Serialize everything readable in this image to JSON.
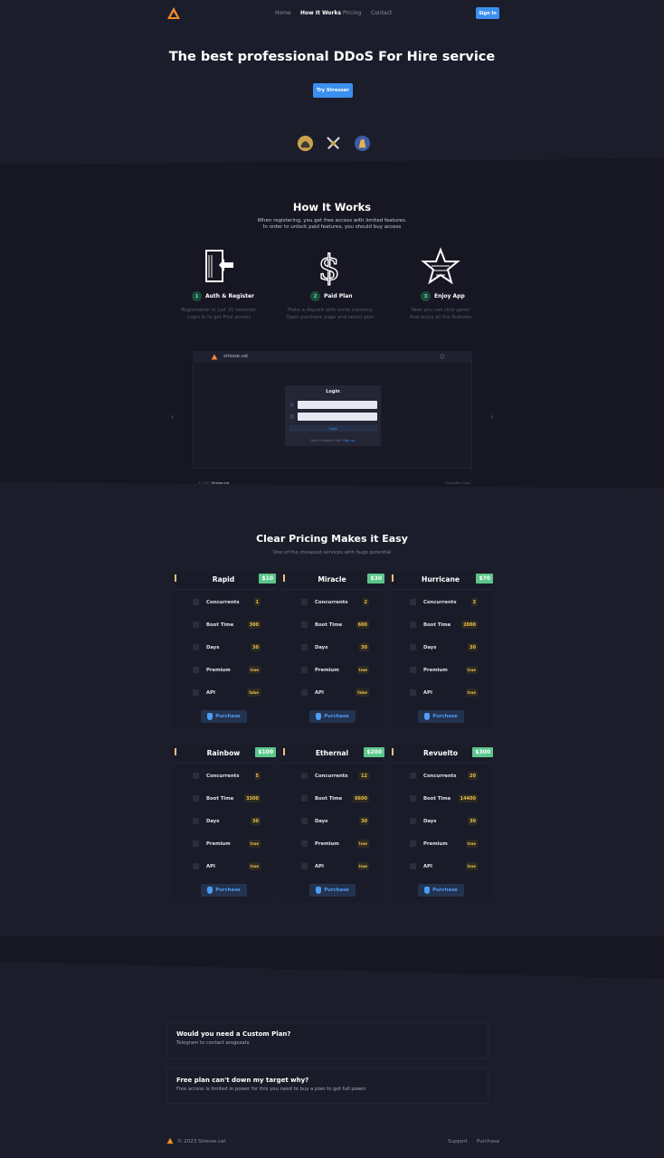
{
  "header": {
    "nav": [
      "Home",
      "How It Works",
      "Pricing",
      "Contact"
    ],
    "active_index": 1,
    "signin_label": "Sign In"
  },
  "hero": {
    "title": "The best professional DDoS For Hire service",
    "cta_label": "Try Stresser"
  },
  "how": {
    "title": "How It Works",
    "subtitle_1": "When registering, you get free access with limited features.",
    "subtitle_2": "In order to unlock paid features, you should buy access",
    "steps": [
      {
        "num": "1",
        "label": "Auth & Register",
        "desc_1": "Registration in just 15 seconds!",
        "desc_2": "Login in to get Free access",
        "icon": "door-enter-icon"
      },
      {
        "num": "2",
        "label": "Paid Plan",
        "desc_1": "Make a deposit with some currency",
        "desc_2": "Open purchase page and select plan",
        "icon": "dollar-icon"
      },
      {
        "num": "3",
        "label": "Enjoy App",
        "desc_1": "Now you can click panel",
        "desc_2": "And enjoy all the features",
        "icon": "star-icon"
      }
    ]
  },
  "mockup": {
    "url": "stresse.cat",
    "login_title": "Login",
    "login_button": "Login",
    "login_footer_text": "Not a member yet?",
    "login_footer_link": "Sign up",
    "footer_left": "© 2023",
    "footer_brand": "Stresse.cat",
    "footer_links": [
      "Support",
      "Purchase"
    ]
  },
  "pricing": {
    "title": "Clear Pricing Makes it Easy",
    "subtitle": "One of the cheapest services with huge potential",
    "feature_labels": [
      "Concurrents",
      "Boot Time",
      "Days",
      "Premium",
      "API"
    ],
    "purchase_label": "Purchase",
    "plans": [
      {
        "name": "Rapid",
        "price": "$10",
        "values": [
          "1",
          "300",
          "30",
          "true",
          "false"
        ]
      },
      {
        "name": "Miracle",
        "price": "$30",
        "values": [
          "2",
          "600",
          "30",
          "true",
          "false"
        ]
      },
      {
        "name": "Hurricane",
        "price": "$70",
        "values": [
          "3",
          "2000",
          "30",
          "true",
          "true"
        ]
      },
      {
        "name": "Rainbow",
        "price": "$100",
        "values": [
          "5",
          "3300",
          "30",
          "true",
          "true"
        ]
      },
      {
        "name": "Ethernal",
        "price": "$200",
        "values": [
          "12",
          "6600",
          "30",
          "true",
          "true"
        ]
      },
      {
        "name": "Revuelto",
        "price": "$300",
        "values": [
          "20",
          "14400",
          "30",
          "true",
          "true"
        ]
      }
    ]
  },
  "faq": [
    {
      "q": "Would you need a Custom Plan?",
      "a": "Telegram to contact arogezats"
    },
    {
      "q": "Free plan can't down my target why?",
      "a": "Free access is limited in power for this you need to buy a plan to get full power"
    }
  ],
  "footer": {
    "copyright": "© 2023 Stresse.cat",
    "links": [
      "Support",
      "Purchase"
    ]
  },
  "colors": {
    "accent": "#3b8ff0",
    "price_green": "#5cc68a",
    "value_yellow": "#f0c14b",
    "logo_orange": "#f08a2c"
  }
}
